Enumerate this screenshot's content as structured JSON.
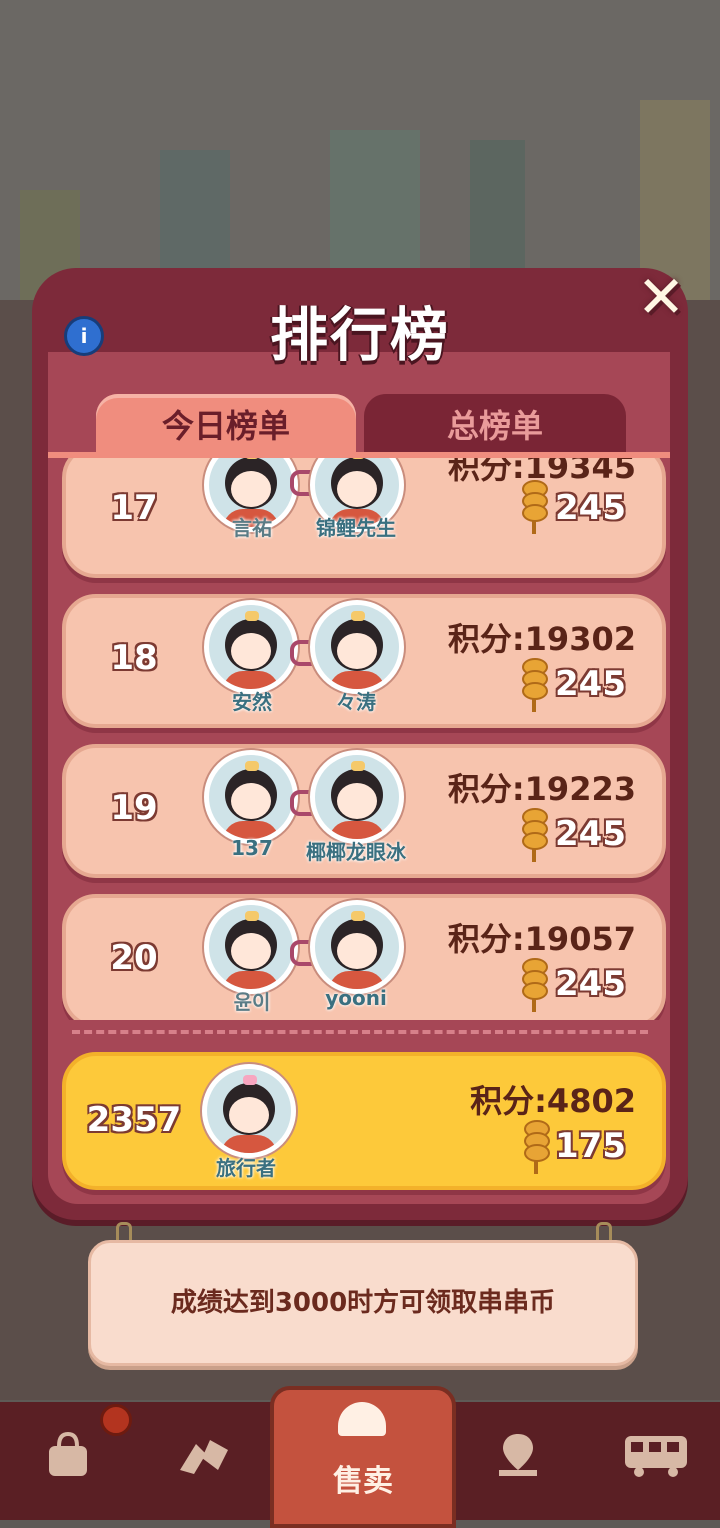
{
  "modal": {
    "title": "排行榜",
    "close_glyph": "✕",
    "info_glyph": "i"
  },
  "tabs": [
    {
      "label": "今日榜单",
      "active": true
    },
    {
      "label": "总榜单",
      "active": false
    }
  ],
  "score_prefix": "积分:",
  "rows": [
    {
      "rank": "17",
      "score": "积分:19345",
      "coins": "245",
      "name_left": "言祐",
      "name_right": "锦鲤先生"
    },
    {
      "rank": "18",
      "score": "积分:19302",
      "coins": "245",
      "name_left": "安然",
      "name_right": "々涛"
    },
    {
      "rank": "19",
      "score": "积分:19223",
      "coins": "245",
      "name_left": "137",
      "name_right": "椰椰龙眼冰"
    },
    {
      "rank": "20",
      "score": "积分:19057",
      "coins": "245",
      "name_left": "윤이",
      "name_right": "yooni"
    }
  ],
  "my_row": {
    "rank": "2357",
    "score": "积分:4802",
    "coins": "175",
    "name": "旅行者"
  },
  "notice": "成绩达到3000时方可领取串串币",
  "bottom_nav": {
    "items": [
      {
        "icon": "bag-icon"
      },
      {
        "icon": "hands-icon"
      },
      {
        "label": "售卖",
        "icon": "bell-icon"
      },
      {
        "icon": "map-icon"
      },
      {
        "icon": "bus-icon"
      }
    ]
  }
}
